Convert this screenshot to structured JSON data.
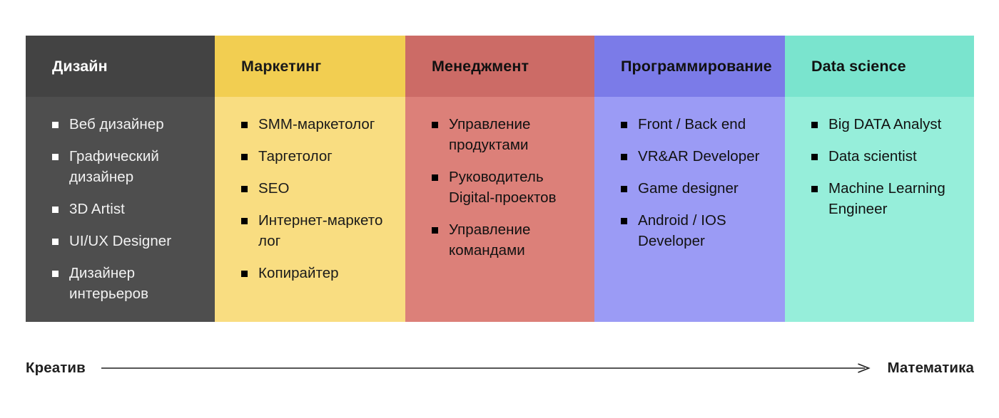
{
  "matrix": {
    "columns": [
      {
        "title": "Дизайн",
        "theme": "c-dark",
        "header_color": "#434343",
        "body_color": "#4e4e4e",
        "text_color": "#ffffff",
        "items": [
          "Веб дизайнер",
          "Графический дизайнер",
          "3D Artist",
          "UI/UX Designer",
          "Дизайнер интерьеров"
        ]
      },
      {
        "title": "Маркетинг",
        "theme": "c-yellow",
        "header_color": "#f2ce51",
        "body_color": "#f9dd81",
        "text_color": "#1a1a1a",
        "items": [
          "SMM-маркетолог",
          "Таргетолог",
          "SEO",
          "Интернет-маркето лог",
          "Копирайтер"
        ]
      },
      {
        "title": "Менеджмент",
        "theme": "c-red",
        "header_color": "#cc6b66",
        "body_color": "#dc8079",
        "text_color": "#111111",
        "items": [
          "Управление продуктами",
          "Руководитель Digital-проектов",
          "Управление командами"
        ]
      },
      {
        "title": "Программирование",
        "theme": "c-purple",
        "header_color": "#7b7be8",
        "body_color": "#9b9bf5",
        "text_color": "#111111",
        "items": [
          "Front / Back end",
          "VR&AR Developer",
          "Game designer",
          "Android / IOS Developer"
        ]
      },
      {
        "title": "Data science",
        "theme": "c-teal",
        "header_color": "#7ae4ce",
        "body_color": "#96eeda",
        "text_color": "#111111",
        "items": [
          "Big DATA Analyst",
          "Data scientist",
          "Machine Learning Engineer"
        ]
      }
    ],
    "bullet_glyph": "filled-square"
  },
  "axis": {
    "left_label": "Креатив",
    "right_label": "Математика",
    "arrow_direction": "left-to-right",
    "line_color": "#1f1f1f"
  }
}
